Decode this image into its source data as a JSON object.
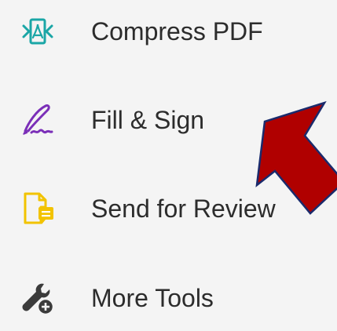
{
  "tools": [
    {
      "label": "Compress PDF",
      "icon": "compress-pdf-icon",
      "color": "#1aa6a6"
    },
    {
      "label": "Fill & Sign",
      "icon": "fill-sign-icon",
      "color": "#7b2fb8"
    },
    {
      "label": "Send for Review",
      "icon": "send-for-review-icon",
      "color": "#f2c300"
    },
    {
      "label": "More Tools",
      "icon": "more-tools-icon",
      "color": "#3b3b3b"
    }
  ],
  "annotation": {
    "arrow_color": "#b00000",
    "arrow_outline": "#1a2a6c"
  }
}
